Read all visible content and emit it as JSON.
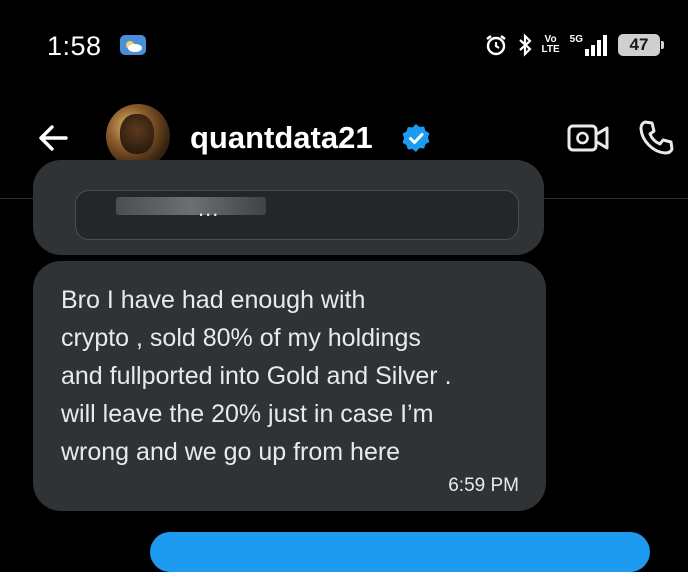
{
  "status_bar": {
    "time": "1:58",
    "lte_top": "Vo",
    "lte_bottom": "LTE",
    "network": "5G",
    "battery": "47"
  },
  "header": {
    "username": "quantdata21",
    "verified": true
  },
  "messages": {
    "previous_more": "...",
    "received": {
      "text": "Bro I have had enough with\ncrypto , sold 80% of my holdings\nand fullported into Gold and Silver .\nwill leave the 20% just in case I’m\nwrong and we go up from here",
      "time": "6:59 PM"
    }
  },
  "colors": {
    "background": "#000000",
    "bubble": "#2f3336",
    "accent": "#1d9bf0",
    "text": "#e8eaed"
  },
  "icons": [
    "back-arrow-icon",
    "verified-badge-icon",
    "video-call-icon",
    "phone-icon",
    "alarm-icon",
    "bluetooth-icon",
    "signal-icon",
    "weather-icon"
  ]
}
